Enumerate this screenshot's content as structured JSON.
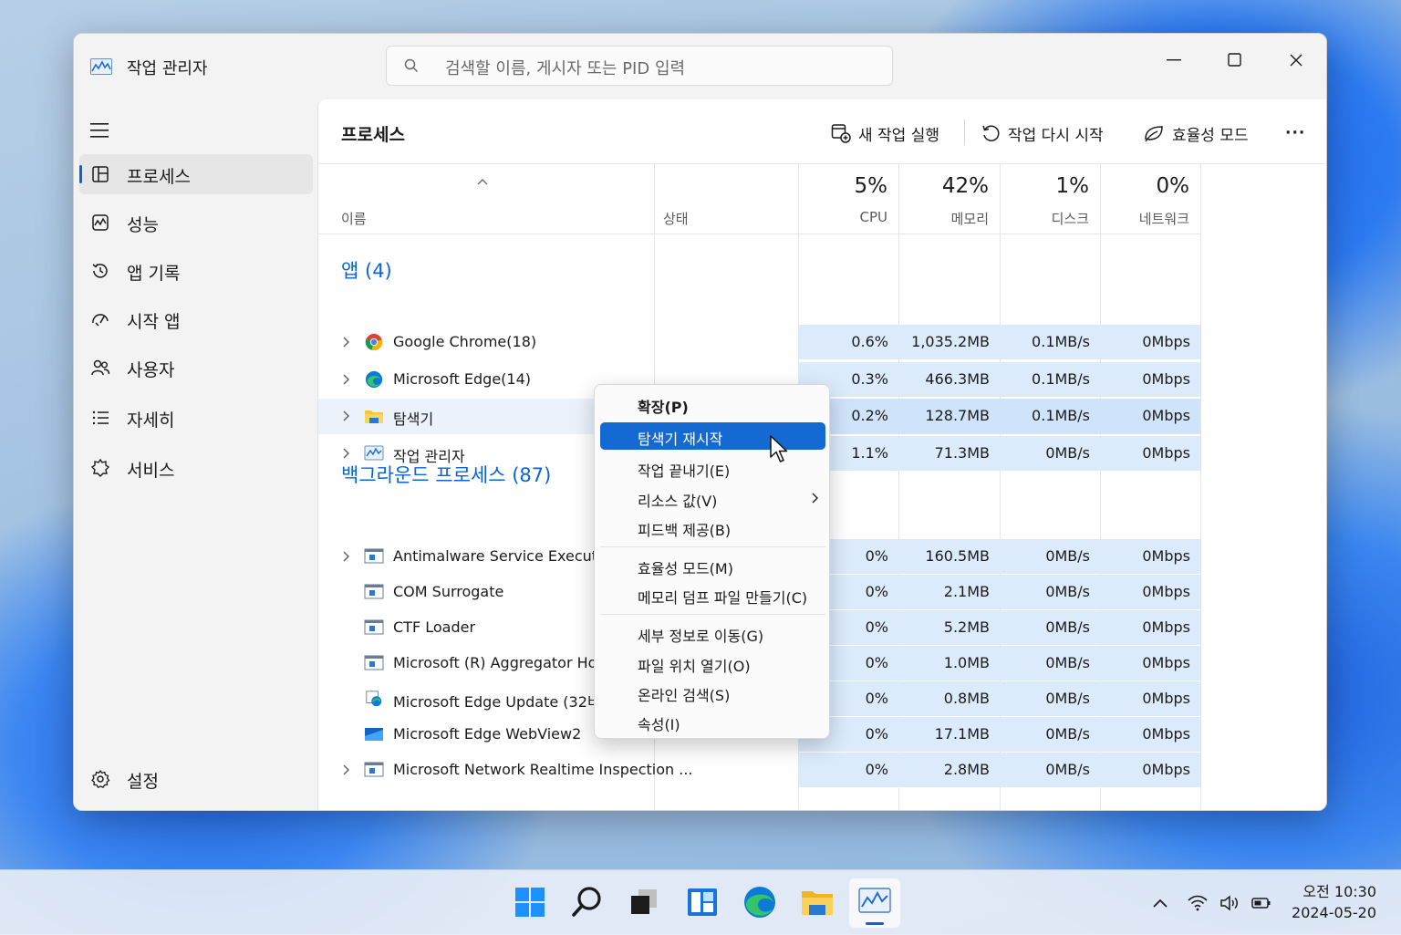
{
  "window": {
    "title": "작업 관리자"
  },
  "search": {
    "placeholder": "검색할 이름, 게시자 또는 PID 입력"
  },
  "sidebar": {
    "items": [
      {
        "label": "프로세스",
        "icon": "processes-icon",
        "active": true
      },
      {
        "label": "성능",
        "icon": "performance-icon"
      },
      {
        "label": "앱 기록",
        "icon": "history-icon"
      },
      {
        "label": "시작 앱",
        "icon": "startup-icon"
      },
      {
        "label": "사용자",
        "icon": "users-icon"
      },
      {
        "label": "자세히",
        "icon": "details-icon"
      },
      {
        "label": "서비스",
        "icon": "services-icon"
      }
    ],
    "settings": "설정"
  },
  "content": {
    "title": "프로세스",
    "toolbar": {
      "new_task": "새 작업 실행",
      "restart_task": "작업 다시 시작",
      "efficiency_mode": "효율성 모드",
      "more": "···"
    },
    "columns": {
      "name": "이름",
      "status": "상태",
      "cpu": {
        "pct": "5%",
        "label": "CPU"
      },
      "memory": {
        "pct": "42%",
        "label": "메모리"
      },
      "disk": {
        "pct": "1%",
        "label": "디스크"
      },
      "network": {
        "pct": "0%",
        "label": "네트워크"
      }
    },
    "groups": {
      "apps": "앱 (4)",
      "background": "백그라운드 프로세스 (87)"
    },
    "apps": [
      {
        "name": "Google Chrome(18)",
        "cpu": "0.6%",
        "memory": "1,035.2MB",
        "disk": "0.1MB/s",
        "network": "0Mbps"
      },
      {
        "name": "Microsoft Edge(14)",
        "cpu": "0.3%",
        "memory": "466.3MB",
        "disk": "0.1MB/s",
        "network": "0Mbps"
      },
      {
        "name": "탐색기",
        "cpu": "0.2%",
        "memory": "128.7MB",
        "disk": "0.1MB/s",
        "network": "0Mbps"
      },
      {
        "name": "작업 관리자",
        "cpu": "1.1%",
        "memory": "71.3MB",
        "disk": "0MB/s",
        "network": "0Mbps"
      }
    ],
    "background": [
      {
        "name": "Antimalware Service Executable",
        "cpu": "0%",
        "memory": "160.5MB",
        "disk": "0MB/s",
        "network": "0Mbps"
      },
      {
        "name": "COM Surrogate",
        "cpu": "0%",
        "memory": "2.1MB",
        "disk": "0MB/s",
        "network": "0Mbps"
      },
      {
        "name": "CTF Loader",
        "cpu": "0%",
        "memory": "5.2MB",
        "disk": "0MB/s",
        "network": "0Mbps"
      },
      {
        "name": "Microsoft (R) Aggregator Host",
        "cpu": "0%",
        "memory": "1.0MB",
        "disk": "0MB/s",
        "network": "0Mbps"
      },
      {
        "name": "Microsoft Edge Update (32비트)",
        "cpu": "0%",
        "memory": "0.8MB",
        "disk": "0MB/s",
        "network": "0Mbps"
      },
      {
        "name": "Microsoft Edge WebView2",
        "cpu": "0%",
        "memory": "17.1MB",
        "disk": "0MB/s",
        "network": "0Mbps"
      },
      {
        "name": "Microsoft Network Realtime Inspection ...",
        "cpu": "0%",
        "memory": "2.8MB",
        "disk": "0MB/s",
        "network": "0Mbps"
      }
    ]
  },
  "context_menu": {
    "items": [
      "확장(P)",
      "탐색기 재시작",
      "작업 끝내기(E)",
      "리소스 값(V)",
      "피드백 제공(B)",
      "효율성 모드(M)",
      "메모리 덤프 파일 만들기(C)",
      "세부 정보로 이동(G)",
      "파일 위치 열기(O)",
      "온라인 검색(S)",
      "속성(I)"
    ]
  },
  "taskbar": {
    "time": "오전 10:30",
    "date": "2024-05-20"
  },
  "colors": {
    "accent": "#0a64d8",
    "heat": "#dcebfc",
    "menu_hover": "#1569d3"
  }
}
